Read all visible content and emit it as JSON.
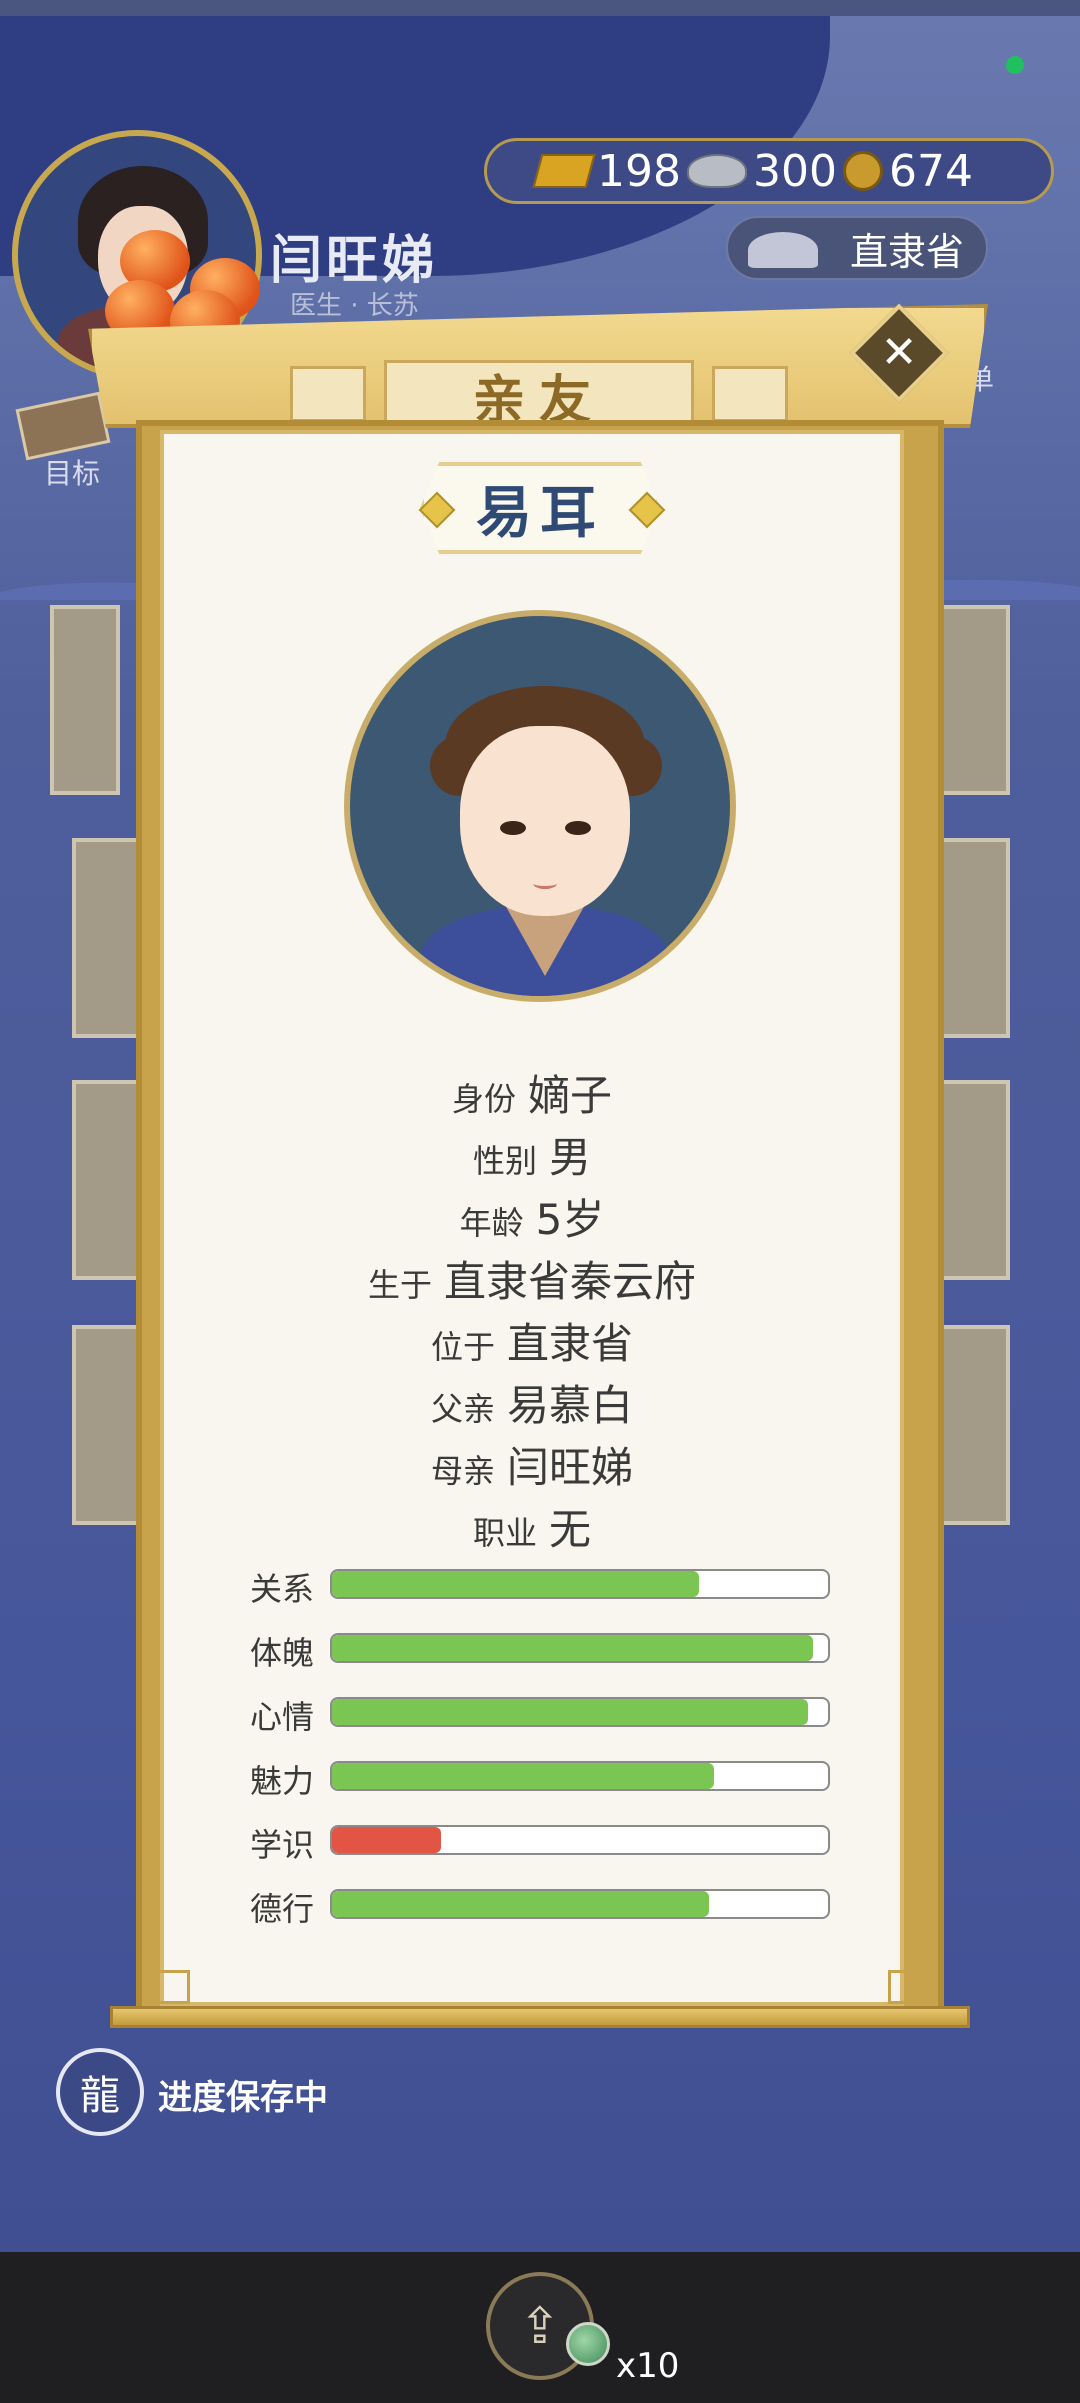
{
  "resources": {
    "gold": "198",
    "silver": "300",
    "coins": "674"
  },
  "player": {
    "name": "闫旺娣",
    "subtitle": "医生 · 长苏"
  },
  "location": "直隶省",
  "menu_label": "菜单",
  "goal_label": "目标",
  "dialog": {
    "tab_title": "亲友",
    "close_symbol": "✕"
  },
  "person": {
    "name": "易耳",
    "info": [
      {
        "label": "身份",
        "value": "嫡子"
      },
      {
        "label": "性别",
        "value": "男"
      },
      {
        "label": "年龄",
        "value": "5岁"
      },
      {
        "label": "生于",
        "value": "直隶省秦云府"
      },
      {
        "label": "位于",
        "value": "直隶省"
      },
      {
        "label": "父亲",
        "value": "易慕白"
      },
      {
        "label": "母亲",
        "value": "闫旺娣"
      },
      {
        "label": "职业",
        "value": "无"
      }
    ],
    "stats": [
      {
        "label": "关系",
        "fraction": 0.74,
        "color": "#7bc653"
      },
      {
        "label": "体魄",
        "fraction": 0.97,
        "color": "#7bc653"
      },
      {
        "label": "心情",
        "fraction": 0.96,
        "color": "#7bc653"
      },
      {
        "label": "魅力",
        "fraction": 0.77,
        "color": "#7bc653"
      },
      {
        "label": "学识",
        "fraction": 0.22,
        "color": "#e25544"
      },
      {
        "label": "德行",
        "fraction": 0.76,
        "color": "#7bc653"
      }
    ]
  },
  "save_status": "进度保存中",
  "share_count": "x10",
  "icons": {
    "gold": "gold-ingot-icon",
    "silver": "silver-ingot-icon",
    "coin": "copper-coin-icon",
    "share": "share-icon",
    "jade": "jade-token-icon"
  }
}
